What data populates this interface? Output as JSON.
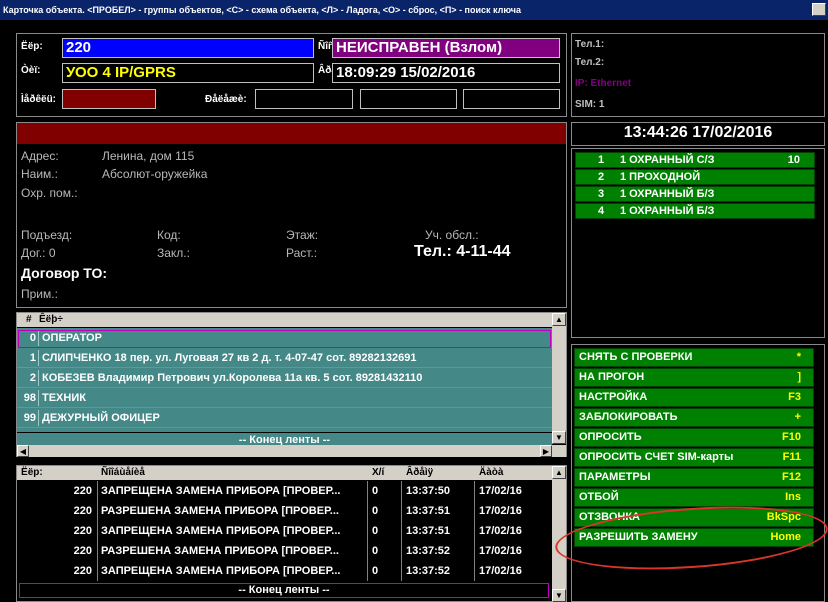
{
  "window": {
    "title": "Карточка объекта. <ПРОБЕЛ> - группы объектов, <С> - схема объекта, <Л> - Ладога, <О> - сброс, <П> - поиск ключа"
  },
  "object": {
    "num_label": "Ёёр:",
    "num_value": "220",
    "status_label": "Ñîñò.:",
    "status_value": "НЕИСПРАВЕН (Взлом)",
    "type_label": "Òèï:",
    "type_value": "УОО 4 IP/GPRS",
    "time_label": "Âðåìÿ:",
    "time_value": "18:09:29 15/02/2016",
    "modem_label": "Ìåðêëü:",
    "relay_label": "Ðåëåæè:"
  },
  "comm": {
    "tel1": "Тел.1:",
    "tel2": "Тел.2:",
    "ip": "IP: Ethernet",
    "sim": "SIM: 1"
  },
  "clock": "13:44:26 17/02/2016",
  "info": {
    "address_label": "Адрес:",
    "address_value": "Ленина, дом 115",
    "name_label": "Наим.:",
    "name_value": "Абсолют-оружейка",
    "guard_label": "Охр. пом.:",
    "entrance_label": "Подъезд:",
    "code_label": "Код:",
    "floor_label": "Этаж:",
    "district_label": "Уч. обсл.:",
    "contract_label": "Дог.: 0",
    "closed_label": "Закл.:",
    "dist_label": "Раст.:",
    "phone": "Тел.: 4-11-44",
    "to_contract": "Договор ТО:",
    "note_label": "Прим.:"
  },
  "keys": {
    "col_num": "#",
    "col_key": "Êëþ÷",
    "rows": [
      {
        "num": "0",
        "text": "ОПЕРАТОР"
      },
      {
        "num": "1",
        "text": "СЛИПЧЕНКО 18 пер. ул. Луговая 27 кв 2 д. т. 4-07-47 сот. 89282132691"
      },
      {
        "num": "2",
        "text": "КОБЕЗЕВ Владимир Петрович ул.Королева 11а кв. 5 сот. 89281432110"
      },
      {
        "num": "98",
        "text": "ТЕХНИК"
      },
      {
        "num": "99",
        "text": "ДЕЖУРНЫЙ ОФИЦЕР"
      }
    ],
    "end": "-- Конец ленты --"
  },
  "events": {
    "headers": {
      "obj": "Ёёр:",
      "msg": "Ñîîáùåíèå",
      "x": "Х/í",
      "time": "Âðåìÿ",
      "date": "Äàòà"
    },
    "rows": [
      {
        "obj": "220",
        "msg": "ЗАПРЕЩЕНА ЗАМЕНА ПРИБОРА [ПРОВЕР...",
        "x": "0",
        "time": "13:37:50",
        "date": "17/02/16"
      },
      {
        "obj": "220",
        "msg": "РАЗРЕШЕНА ЗАМЕНА ПРИБОРА [ПРОВЕР...",
        "x": "0",
        "time": "13:37:51",
        "date": "17/02/16"
      },
      {
        "obj": "220",
        "msg": "ЗАПРЕЩЕНА ЗАМЕНА ПРИБОРА [ПРОВЕР...",
        "x": "0",
        "time": "13:37:51",
        "date": "17/02/16"
      },
      {
        "obj": "220",
        "msg": "РАЗРЕШЕНА ЗАМЕНА ПРИБОРА [ПРОВЕР...",
        "x": "0",
        "time": "13:37:52",
        "date": "17/02/16"
      },
      {
        "obj": "220",
        "msg": "ЗАПРЕЩЕНА ЗАМЕНА ПРИБОРА [ПРОВЕР...",
        "x": "0",
        "time": "13:37:52",
        "date": "17/02/16"
      }
    ],
    "end": "-- Конец ленты --"
  },
  "zones": [
    {
      "num": "1",
      "name": "1 ОХРАННЫЙ С/З",
      "value": "10"
    },
    {
      "num": "2",
      "name": "1 ПРОХОДНОЙ",
      "value": ""
    },
    {
      "num": "3",
      "name": "1 ОХРАННЫЙ Б/З",
      "value": ""
    },
    {
      "num": "4",
      "name": "1 ОХРАННЫЙ Б/З",
      "value": ""
    }
  ],
  "commands": [
    {
      "label": "СНЯТЬ С ПРОВЕРКИ",
      "key": "*"
    },
    {
      "label": "НА ПРОГОН",
      "key": "]"
    },
    {
      "label": "НАСТРОЙКА",
      "key": "F3"
    },
    {
      "label": "ЗАБЛОКИРОВАТЬ",
      "key": "+"
    },
    {
      "label": "ОПРОСИТЬ",
      "key": "F10"
    },
    {
      "label": "ОПРОСИТЬ СЧЕТ SIM-карты",
      "key": "F11"
    },
    {
      "label": "ПАРАМЕТРЫ",
      "key": "F12"
    },
    {
      "label": "ОТБОЙ",
      "key": "Ins"
    },
    {
      "label": "ОТЗВОНКА",
      "key": "BkSpc"
    },
    {
      "label": "РАЗРЕШИТЬ ЗАМЕНУ",
      "key": "Home"
    }
  ],
  "colors": {
    "field_blue": "#0000ff",
    "status_purple": "#800080",
    "type_yellow": "#ffff00",
    "alarm_red": "#800000",
    "list_teal": "#448888",
    "button_green": "#008000",
    "annotation_red": "#d9362b"
  }
}
